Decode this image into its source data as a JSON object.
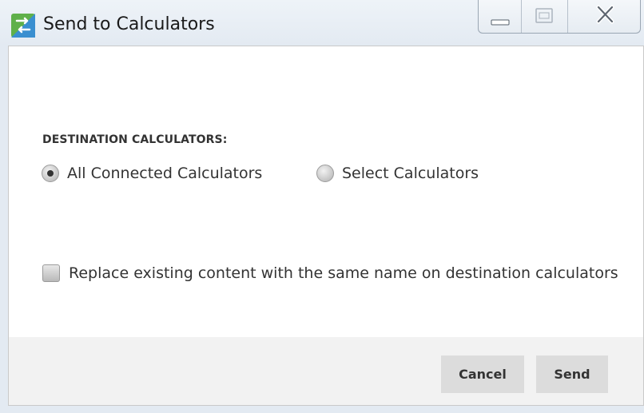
{
  "window": {
    "title": "Send to Calculators",
    "icon": "transfer-arrows-icon",
    "controls": {
      "minimize_icon": "minimize-icon",
      "maximize_icon": "maximize-icon",
      "close_icon": "close-icon"
    }
  },
  "form": {
    "section_label": "DESTINATION CALCULATORS:",
    "radios": [
      {
        "label": "All Connected Calculators",
        "selected": true
      },
      {
        "label": "Select Calculators",
        "selected": false
      }
    ],
    "replace_checkbox": {
      "label": "Replace existing content with the same name on destination calculators",
      "checked": false
    }
  },
  "buttons": {
    "cancel_label": "Cancel",
    "send_label": "Send"
  },
  "colors": {
    "icon_green": "#5fb04a",
    "icon_blue": "#3a8fd0",
    "button_bg": "#dcdcdc",
    "footer_bg": "#f2f2f2"
  }
}
